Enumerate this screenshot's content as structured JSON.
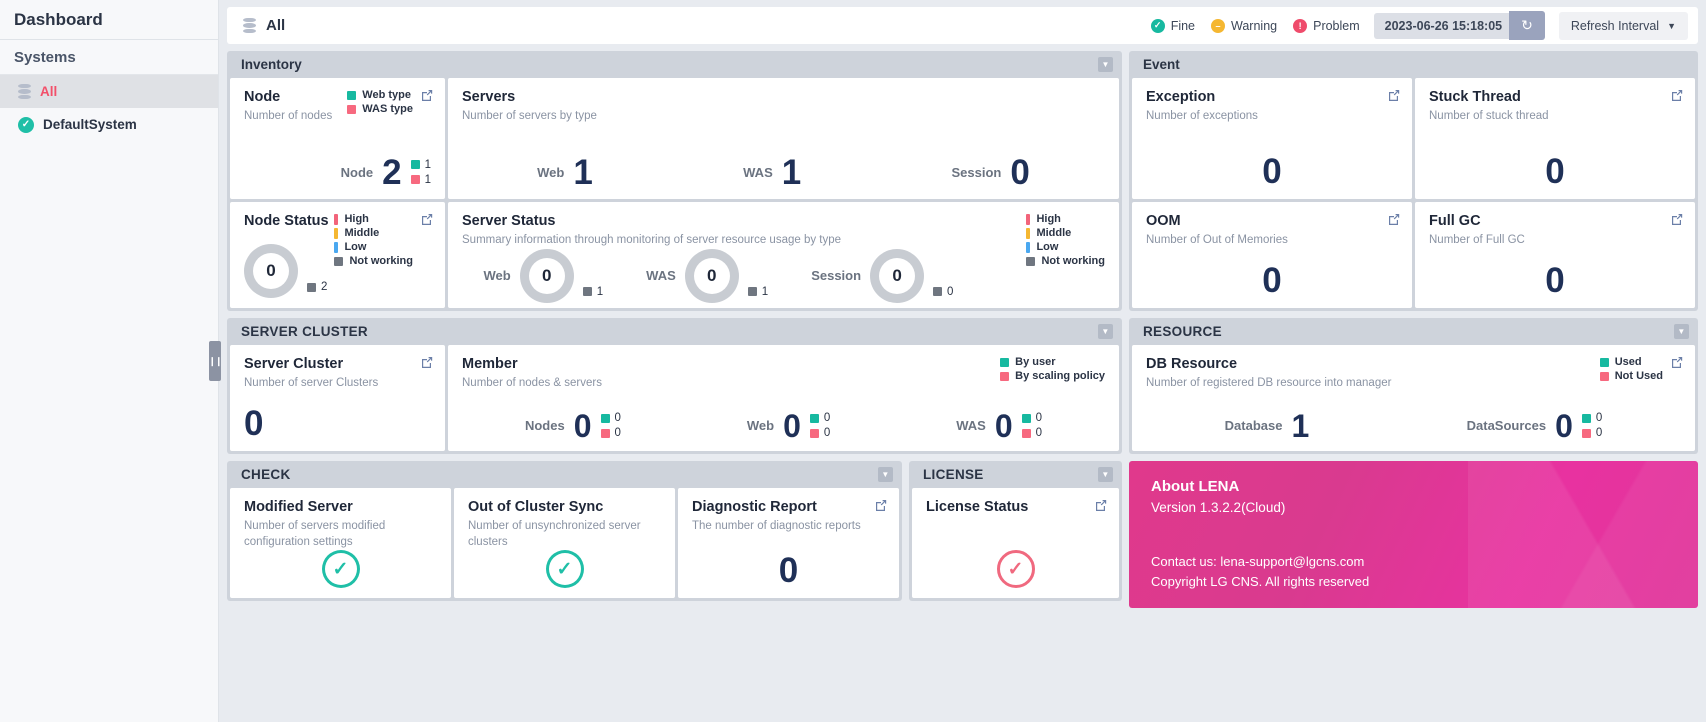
{
  "sidebar": {
    "header": "Dashboard",
    "section": "Systems",
    "items": [
      {
        "label": "All",
        "icon": "database-icon"
      },
      {
        "label": "DefaultSystem",
        "icon": "check-circle-icon"
      }
    ]
  },
  "topbar": {
    "title": "All",
    "status": [
      {
        "label": "Fine",
        "color": "#17b9a0"
      },
      {
        "label": "Warning",
        "color": "#f5b731"
      },
      {
        "label": "Problem",
        "color": "#ef4b6b"
      }
    ],
    "timestamp": "2023-06-26 15:18:05",
    "refresh_label": "↻",
    "interval_label": "Refresh Interval"
  },
  "panels": {
    "inventory": {
      "title": "Inventory",
      "node": {
        "title": "Node",
        "sub": "Number of nodes",
        "legend": [
          {
            "label": "Web type",
            "color": "#17b9a0"
          },
          {
            "label": "WAS type",
            "color": "#f7697f"
          }
        ],
        "metric_label": "Node",
        "metric_value": "2",
        "counts": [
          {
            "value": "1",
            "color": "#17b9a0"
          },
          {
            "value": "1",
            "color": "#f7697f"
          }
        ]
      },
      "servers": {
        "title": "Servers",
        "sub": "Number of servers by type",
        "metrics": [
          {
            "label": "Web",
            "value": "1"
          },
          {
            "label": "WAS",
            "value": "1"
          },
          {
            "label": "Session",
            "value": "0"
          }
        ]
      },
      "node_status": {
        "title": "Node Status",
        "legend": [
          {
            "label": "High",
            "color": "#f2647a"
          },
          {
            "label": "Middle",
            "color": "#f5b731"
          },
          {
            "label": "Low",
            "color": "#4aa8f0"
          },
          {
            "label": "Not working",
            "color": "#6f7680"
          }
        ],
        "gauge_value": "0",
        "count": {
          "value": "2",
          "color": "#6f7680"
        }
      },
      "server_status": {
        "title": "Server Status",
        "sub": "Summary information through monitoring of server resource usage by type",
        "legend": [
          {
            "label": "High",
            "color": "#f2647a"
          },
          {
            "label": "Middle",
            "color": "#f5b731"
          },
          {
            "label": "Low",
            "color": "#4aa8f0"
          },
          {
            "label": "Not working",
            "color": "#6f7680"
          }
        ],
        "gauges": [
          {
            "label": "Web",
            "value": "0",
            "count": "1"
          },
          {
            "label": "WAS",
            "value": "0",
            "count": "1"
          },
          {
            "label": "Session",
            "value": "0",
            "count": "0"
          }
        ]
      }
    },
    "event": {
      "title": "Event",
      "cards": [
        {
          "title": "Exception",
          "sub": "Number of exceptions",
          "value": "0"
        },
        {
          "title": "Stuck Thread",
          "sub": "Number of stuck thread",
          "value": "0"
        },
        {
          "title": "OOM",
          "sub": "Number of Out of Memories",
          "value": "0"
        },
        {
          "title": "Full GC",
          "sub": "Number of Full GC",
          "value": "0"
        }
      ]
    },
    "server_cluster": {
      "title": "SERVER CLUSTER",
      "cluster": {
        "title": "Server Cluster",
        "sub": "Number of server Clusters",
        "value": "0"
      },
      "member": {
        "title": "Member",
        "sub": "Number of nodes & servers",
        "legend": [
          {
            "label": "By user",
            "color": "#17b9a0"
          },
          {
            "label": "By scaling policy",
            "color": "#f7697f"
          }
        ],
        "metrics": [
          {
            "label": "Nodes",
            "value": "0",
            "counts": [
              {
                "value": "0",
                "color": "#17b9a0"
              },
              {
                "value": "0",
                "color": "#f7697f"
              }
            ]
          },
          {
            "label": "Web",
            "value": "0",
            "counts": [
              {
                "value": "0",
                "color": "#17b9a0"
              },
              {
                "value": "0",
                "color": "#f7697f"
              }
            ]
          },
          {
            "label": "WAS",
            "value": "0",
            "counts": [
              {
                "value": "0",
                "color": "#17b9a0"
              },
              {
                "value": "0",
                "color": "#f7697f"
              }
            ]
          }
        ]
      }
    },
    "resource": {
      "title": "RESOURCE",
      "db": {
        "title": "DB Resource",
        "sub": "Number of registered DB resource into manager",
        "legend": [
          {
            "label": "Used",
            "color": "#17b9a0"
          },
          {
            "label": "Not Used",
            "color": "#f7697f"
          }
        ],
        "metrics": [
          {
            "label": "Database",
            "value": "1",
            "counts": []
          },
          {
            "label": "DataSources",
            "value": "0",
            "counts": [
              {
                "value": "0",
                "color": "#17b9a0"
              },
              {
                "value": "0",
                "color": "#f7697f"
              }
            ]
          }
        ]
      }
    },
    "check": {
      "title": "CHECK",
      "cards": [
        {
          "title": "Modified Server",
          "sub": "Number of servers modified configuration settings",
          "indicator": "check-ok"
        },
        {
          "title": "Out of Cluster Sync",
          "sub": "Number of unsynchronized server clusters",
          "indicator": "check-ok"
        },
        {
          "title": "Diagnostic Report",
          "sub": "The number of diagnostic reports",
          "value": "0"
        }
      ]
    },
    "license": {
      "title": "LICENSE",
      "card": {
        "title": "License Status",
        "indicator": "check-red"
      }
    },
    "about": {
      "title": "About LENA",
      "version": "Version 1.3.2.2(Cloud)",
      "contact": "Contact us: lena-support@lgcns.com",
      "copyright": "Copyright LG CNS. All rights reserved"
    }
  }
}
